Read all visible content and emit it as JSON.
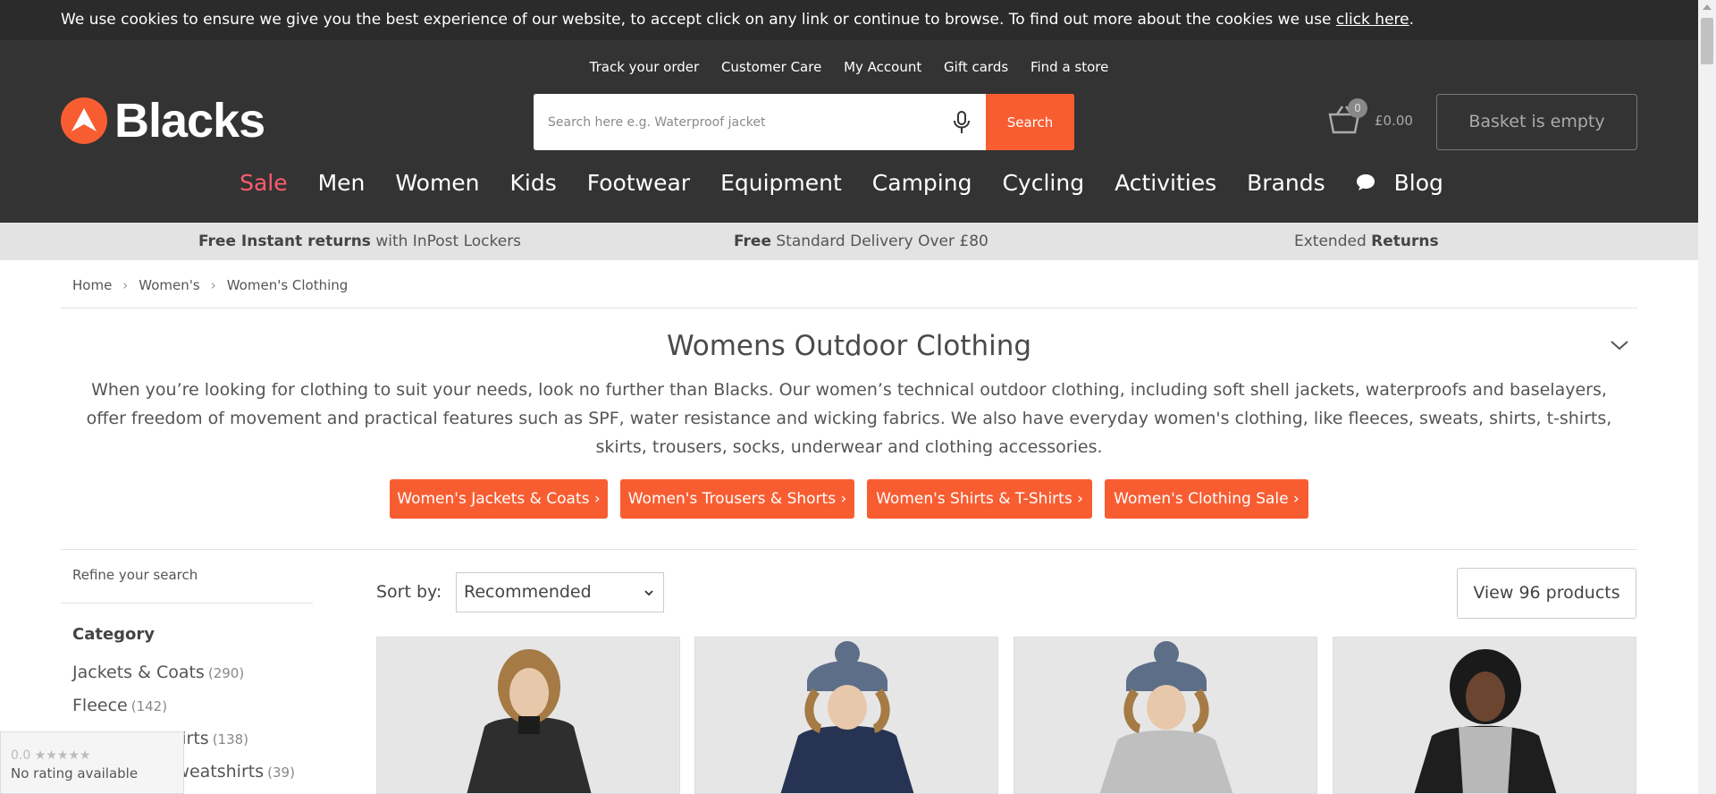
{
  "cookie_bar": {
    "text": "We use cookies to ensure we give you the best experience of our website, to accept click on any link or continue to browse. To find out more about the cookies we use ",
    "link": "click here",
    "end": "."
  },
  "util_nav": [
    "Track your order",
    "Customer Care",
    "My Account",
    "Gift cards",
    "Find a store"
  ],
  "logo": {
    "text": "Blacks"
  },
  "search": {
    "placeholder": "Search here e.g. Waterproof jacket",
    "value": "",
    "button": "Search"
  },
  "basket": {
    "count": "0",
    "price": "£0.00",
    "status": "Basket is empty"
  },
  "main_nav": [
    "Sale",
    "Men",
    "Women",
    "Kids",
    "Footwear",
    "Equipment",
    "Camping",
    "Cycling",
    "Activities",
    "Brands",
    "Blog"
  ],
  "usp": [
    {
      "bold": "Free Instant returns",
      "text": " with InPost Lockers"
    },
    {
      "bold": "Free",
      "text": " Standard Delivery Over £80"
    },
    {
      "text": "Extended ",
      "bold": "Returns"
    }
  ],
  "breadcrumb": [
    "Home",
    "Women's",
    "Women's Clothing"
  ],
  "page": {
    "title": "Womens Outdoor Clothing",
    "intro": "When you’re looking for clothing to suit your needs, look no further than Blacks. Our women’s technical outdoor clothing, including soft shell jackets, waterproofs and baselayers, offer freedom of movement and practical features such as SPF, water resistance and wicking fabrics. We also have everyday women's clothing, like fleeces, sweats, shirts, t-shirts, skirts, trousers, socks, underwear and clothing accessories."
  },
  "cta_buttons": [
    "Women's Jackets & Coats ›",
    "Women's Trousers & Shorts ›",
    "Women's Shirts & T-Shirts ›",
    "Women's Clothing Sale ›"
  ],
  "filters": {
    "refine_label": "Refine your search",
    "category_title": "Category",
    "categories": [
      {
        "label": "Jackets & Coats",
        "count": "(290)"
      },
      {
        "label": "Fleece",
        "count": "(142)"
      },
      {
        "label": "Shirts & T-Shirts",
        "count": "(138)"
      },
      {
        "label": "Hoodies & Sweatshirts",
        "count": "(39)"
      }
    ]
  },
  "toolbar": {
    "sort_label": "Sort by:",
    "sort_value": "Recommended",
    "view_button": "View 96 products"
  },
  "rating_widget": {
    "stars": "0.0 ★★★★★",
    "text": "No rating available"
  },
  "colors": {
    "brand_orange": "#f85d32",
    "header_bg": "#333333",
    "sale_red": "#ff5c6f"
  }
}
